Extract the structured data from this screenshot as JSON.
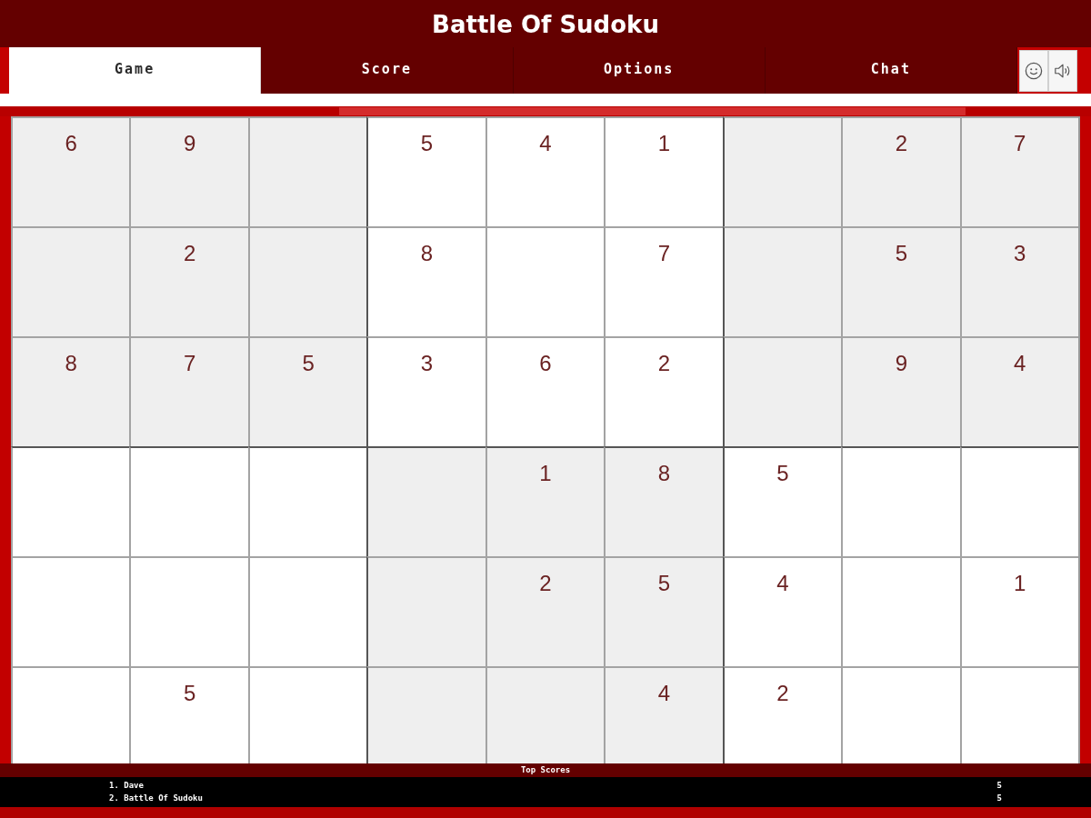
{
  "window": {
    "title": "Battle Of Sudoku"
  },
  "tabs": [
    {
      "label": "Game",
      "selected": true
    },
    {
      "label": "Score",
      "selected": false
    },
    {
      "label": "Options",
      "selected": false
    },
    {
      "label": "Chat",
      "selected": false
    }
  ],
  "board": {
    "rows": [
      [
        "6",
        "9",
        null,
        "5",
        "4",
        "1",
        null,
        "2",
        "7"
      ],
      [
        null,
        "2",
        null,
        "8",
        null,
        "7",
        null,
        "5",
        "3"
      ],
      [
        "8",
        "7",
        "5",
        "3",
        "6",
        "2",
        null,
        "9",
        "4"
      ],
      [
        null,
        null,
        null,
        null,
        "1",
        "8",
        "5",
        null,
        null
      ],
      [
        null,
        null,
        null,
        null,
        "2",
        "5",
        "4",
        null,
        "1"
      ],
      [
        null,
        "5",
        null,
        null,
        null,
        "4",
        "2",
        null,
        null
      ]
    ]
  },
  "top_scores": {
    "title": "Top Scores",
    "entries": [
      {
        "name": "1. Dave",
        "score": "5"
      },
      {
        "name": "2. Battle Of Sudoku",
        "score": "5"
      }
    ]
  }
}
